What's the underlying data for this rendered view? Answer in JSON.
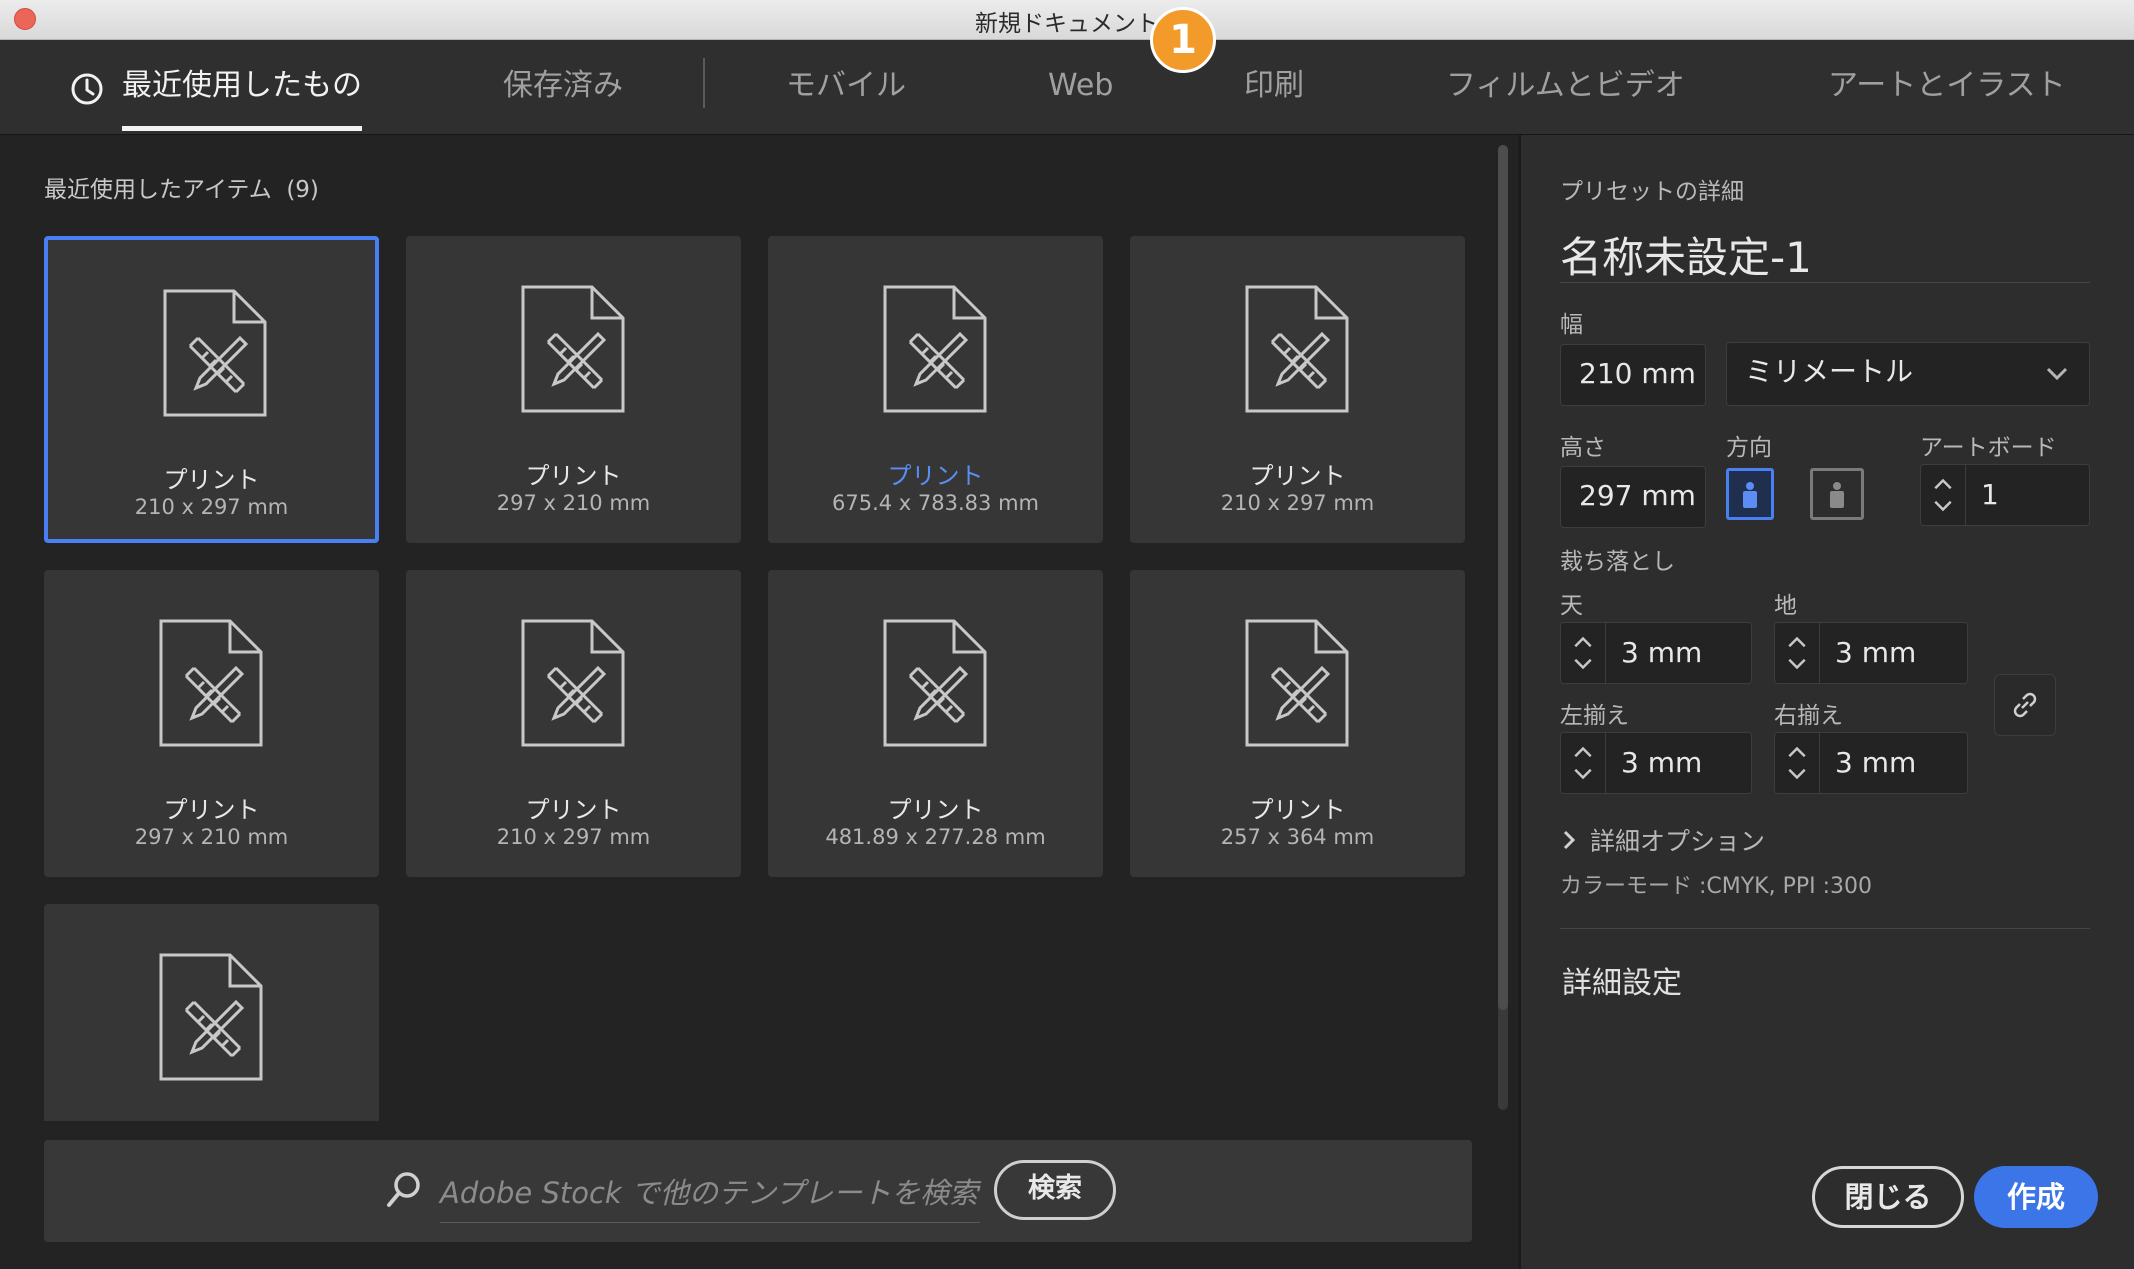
{
  "window": {
    "title": "新規ドキュメント",
    "badge": "1"
  },
  "tabs": [
    {
      "label": "最近使用したもの"
    },
    {
      "label": "保存済み"
    },
    {
      "label": "モバイル"
    },
    {
      "label": "Web"
    },
    {
      "label": "印刷"
    },
    {
      "label": "フィルムとビデオ"
    },
    {
      "label": "アートとイラスト"
    }
  ],
  "recent": {
    "heading": "最近使用したアイテム",
    "count": "(9)",
    "items": [
      {
        "name": "プリント",
        "size": "210 x 297 mm"
      },
      {
        "name": "プリント",
        "size": "297 x 210 mm"
      },
      {
        "name": "プリント",
        "size": "675.4 x 783.83 mm"
      },
      {
        "name": "プリント",
        "size": "210 x 297 mm"
      },
      {
        "name": "プリント",
        "size": "297 x 210 mm"
      },
      {
        "name": "プリント",
        "size": "210 x 297 mm"
      },
      {
        "name": "プリント",
        "size": "481.89 x 277.28 mm"
      },
      {
        "name": "プリント",
        "size": "257 x 364 mm"
      }
    ]
  },
  "stock": {
    "placeholder": "Adobe Stock で他のテンプレートを検索",
    "button": "検索"
  },
  "preset": {
    "section_label": "プリセットの詳細",
    "name": "名称未設定-1",
    "width_label": "幅",
    "width_value": "210 mm",
    "unit_value": "ミリメートル",
    "height_label": "高さ",
    "height_value": "297 mm",
    "orientation_label": "方向",
    "artboard_label": "アートボード",
    "artboard_value": "1",
    "bleed_label": "裁ち落とし",
    "bleed_top_label": "天",
    "bleed_top_value": "3 mm",
    "bleed_bottom_label": "地",
    "bleed_bottom_value": "3 mm",
    "bleed_left_label": "左揃え",
    "bleed_left_value": "3 mm",
    "bleed_right_label": "右揃え",
    "bleed_right_value": "3 mm",
    "advanced_options": "詳細オプション",
    "color_mode": "カラーモード :CMYK, PPI :300",
    "more_settings": "詳細設定"
  },
  "buttons": {
    "close": "閉じる",
    "create": "作成"
  },
  "colors": {
    "accent": "#3b75e8",
    "selection_border": "#4a7ff1",
    "highlight_text": "#5b8df5",
    "badge": "#f29b2a"
  }
}
